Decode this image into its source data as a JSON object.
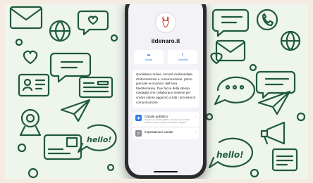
{
  "channel": {
    "name": "ildenaro.it",
    "avatar_icon": "deer-logo-icon"
  },
  "actions": [
    {
      "label": "Inoltra",
      "icon": "forward-icon"
    },
    {
      "label": "Condividi",
      "icon": "share-icon"
    }
  ],
  "description": "Quotidiano online, società multimediale d'informazione e comunicazione, primo giornale economico dell'area Mediterranea. Due facce della stessa medaglia che collaborano insieme per creare valore aggiunto a tutti i processi di comunicazione.",
  "settings": {
    "public_channel": {
      "title": "Canale pubblico",
      "subtitle": "Questo è un canale pubblico, chiunque può trovarlo tramite la ricerca, vederne i contenuti e seguirlo.",
      "icon": "globe-icon"
    },
    "channel_settings": {
      "title": "Impostazioni canale",
      "icon": "gear-icon"
    }
  },
  "doodles": {
    "hello_label": "hello!"
  },
  "colors": {
    "doodle": "#1f5a3c",
    "background": "#eef5ec",
    "accent": "#1a73e8"
  }
}
